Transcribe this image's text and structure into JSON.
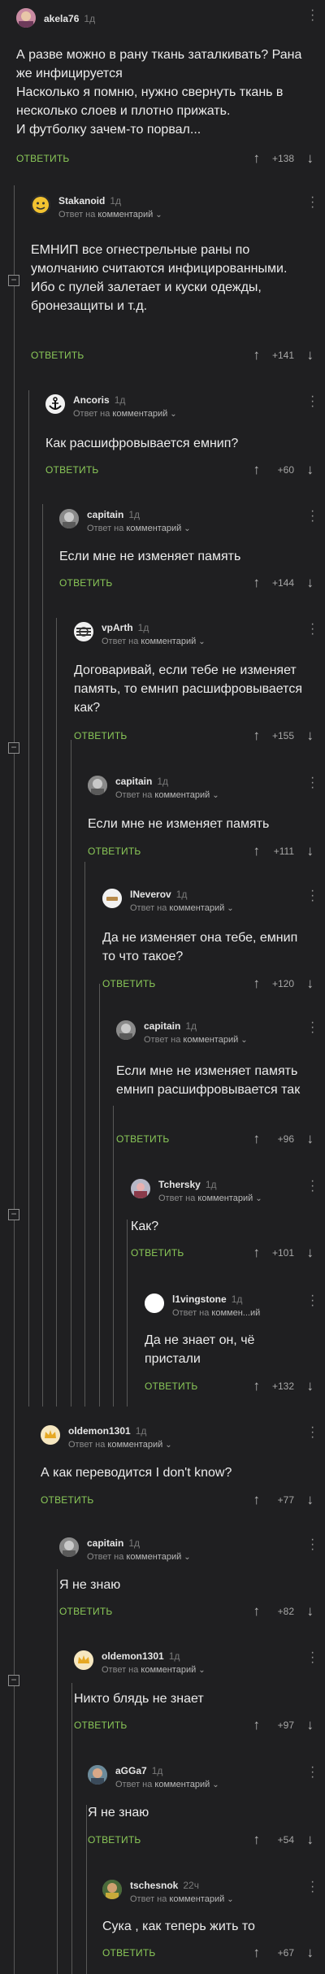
{
  "labels": {
    "reply_prefix": "Ответ на",
    "reply_target": "комментарий",
    "reply_target_short": "коммен...ий",
    "answer": "ОТВЕТИТЬ",
    "collapse": "−"
  },
  "comments": [
    {
      "user": "akela76",
      "time": "1д",
      "reply": false,
      "body": "А разве можно в рану ткань заталкивать? Рана же инфицируется\nНасколько я помню, нужно свернуть ткань в несколько слоев и плотно прижать.\nИ футболку зачем-то порвал...",
      "rating": "+138",
      "avatar": "akela76-avatar"
    },
    {
      "user": "Stakanoid",
      "time": "1д",
      "reply": true,
      "body": "ЕМНИП все огнестрельные раны по умолчанию считаются инфицированными. Ибо с пулей залетает и куски одежды, бронезащиты и т.д.",
      "rating": "+141",
      "avatar": "emoji-avatar"
    },
    {
      "user": "Ancoris",
      "time": "1д",
      "reply": true,
      "body": "Как расшифровывается емнип?",
      "rating": "+60",
      "avatar": "anchor-avatar"
    },
    {
      "user": "capitain",
      "time": "1д",
      "reply": true,
      "body": "Если мне не изменяет память",
      "rating": "+144",
      "avatar": "capitain-avatar"
    },
    {
      "user": "vpArth",
      "time": "1д",
      "reply": true,
      "body": "Договаривай, если тебе не изменяет память, то емнип расшифровывается как?",
      "rating": "+155",
      "avatar": "pattern-avatar"
    },
    {
      "user": "capitain",
      "time": "1д",
      "reply": true,
      "body": "Если мне не изменяет память",
      "rating": "+111",
      "avatar": "capitain-avatar"
    },
    {
      "user": "INeverov",
      "time": "1д",
      "reply": true,
      "body": "Да не изменяет она тебе, емнип то что такое?",
      "rating": "+120",
      "avatar": "ineverov-avatar"
    },
    {
      "user": "capitain",
      "time": "1д",
      "reply": true,
      "body": "Если мне не изменяет память емнип расшифровывается так",
      "rating": "+96",
      "avatar": "capitain-avatar"
    },
    {
      "user": "Tchersky",
      "time": "1д",
      "reply": true,
      "body": "Как?",
      "rating": "+101",
      "avatar": "tchersky-avatar"
    },
    {
      "user": "l1vingstone",
      "time": "1д",
      "reply": true,
      "short": true,
      "body": "Да не знает он, чё пристали",
      "rating": "+132",
      "avatar": "white-avatar"
    },
    {
      "user": "oldemon1301",
      "time": "1д",
      "reply": true,
      "body": "А как переводится I don't know?",
      "rating": "+77",
      "avatar": "crown-avatar"
    },
    {
      "user": "capitain",
      "time": "1д",
      "reply": true,
      "body": "Я не знаю",
      "rating": "+82",
      "avatar": "capitain-avatar"
    },
    {
      "user": "oldemon1301",
      "time": "1д",
      "reply": true,
      "body": "Никто блядь не знает",
      "rating": "+97",
      "avatar": "crown-avatar"
    },
    {
      "user": "aGGa7",
      "time": "1д",
      "reply": true,
      "body": "Я не знаю",
      "rating": "+54",
      "avatar": "agga7-avatar"
    },
    {
      "user": "tschesnok",
      "time": "22ч",
      "reply": true,
      "body": "Сука , как теперь жить то",
      "rating": "+67",
      "avatar": "tschesnok-avatar"
    }
  ]
}
